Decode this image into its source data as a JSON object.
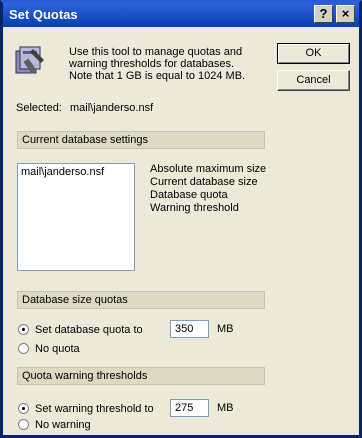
{
  "window": {
    "title": "Set Quotas",
    "help_label": "?",
    "close_label": "×"
  },
  "intro_text": "Use this tool to manage quotas and\nwarning thresholds for databases.\nNote that 1 GB is equal to 1024 MB.",
  "buttons": {
    "ok": "OK",
    "cancel": "Cancel"
  },
  "selected": {
    "label": "Selected:",
    "value": "mail\\janderso.nsf"
  },
  "current_settings": {
    "header": "Current database settings",
    "list_items": [
      "mail\\janderso.nsf"
    ],
    "labels": [
      "Absolute maximum size",
      "Current database size",
      "Database quota",
      "Warning threshold"
    ]
  },
  "size_quotas": {
    "header": "Database size quotas",
    "set_quota_label": "Set database quota to",
    "quota_value": "350",
    "unit": "MB",
    "no_quota_label": "No quota",
    "selected_option": "set"
  },
  "warning_thresholds": {
    "header": "Quota warning thresholds",
    "set_warning_label": "Set warning threshold to",
    "threshold_value": "275",
    "unit": "MB",
    "no_warning_label": "No warning",
    "selected_option": "set"
  }
}
